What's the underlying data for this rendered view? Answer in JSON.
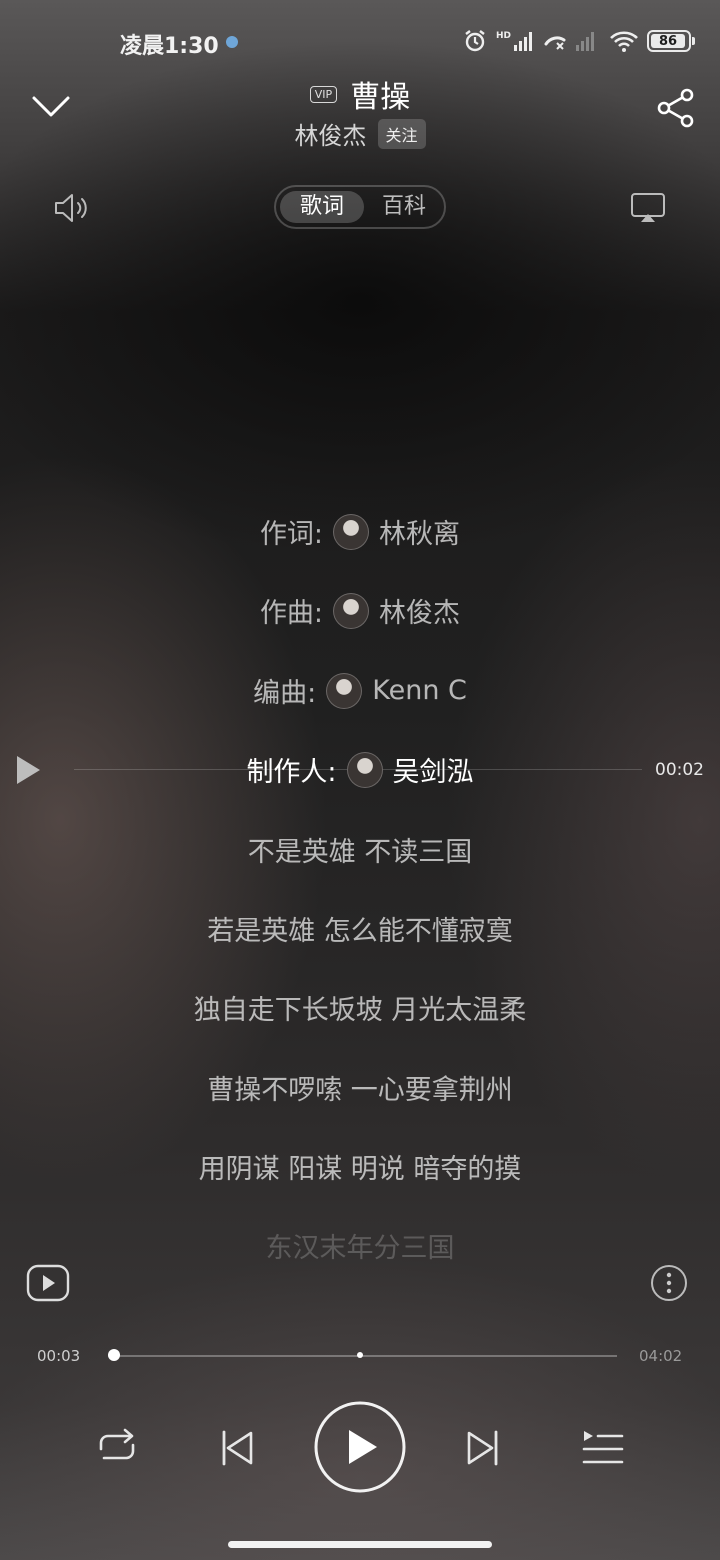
{
  "status_bar": {
    "time": "凌晨1:30",
    "network": "HD",
    "battery": "86"
  },
  "header": {
    "badge": "VIP",
    "song_title": "曹操",
    "artist": "林俊杰",
    "follow_label": "关注"
  },
  "tabs": [
    "歌词",
    "百科"
  ],
  "credits": [
    {
      "role": "作词:",
      "name": "林秋离"
    },
    {
      "role": "作曲:",
      "name": "林俊杰"
    },
    {
      "role": "编曲:",
      "name": "Kenn C"
    },
    {
      "role": "制作人:",
      "name": "吴剑泓"
    }
  ],
  "lyrics": [
    "不是英雄 不读三国",
    "若是英雄 怎么能不懂寂寞",
    "独自走下长坂坡 月光太温柔",
    "曹操不啰嗦 一心要拿荆州",
    "用阴谋 阳谋 明说 暗夺的摸",
    "东汉末年分三国"
  ],
  "seek_time": "00:02",
  "progress": {
    "current": "00:03",
    "total": "04:02",
    "fraction": 0.012
  },
  "icons": {
    "collapse": "chevron-down-icon",
    "share": "share-icon",
    "volume": "volume-icon",
    "cast": "cast-icon",
    "play_from_line": "play-icon",
    "video": "video-icon",
    "more": "more-icon",
    "repeat": "repeat-icon",
    "previous": "previous-icon",
    "play": "play-icon",
    "next": "next-icon",
    "playlist": "playlist-icon"
  }
}
